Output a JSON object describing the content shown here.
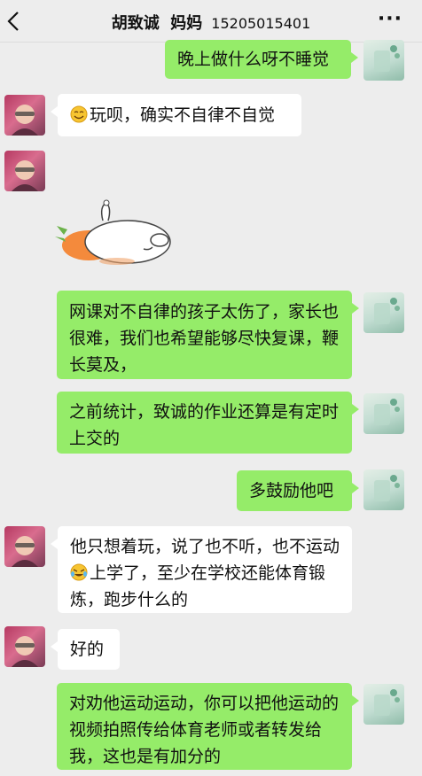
{
  "header": {
    "title": "胡致诚  妈妈",
    "phone": "15205015401",
    "more_icon": "more-dots-icon",
    "back_icon": "back-chevron-icon"
  },
  "colors": {
    "background": "#ededed",
    "sent_bubble": "#95ec69",
    "received_bubble": "#ffffff"
  },
  "messages": [
    {
      "from": "me",
      "text": "晚上做什么呀不睡觉"
    },
    {
      "from": "mom",
      "text": "玩呗，确实不自律不自觉",
      "emoji": "smile-emoji-icon"
    },
    {
      "from": "mom",
      "sticker": "sleeping-rabbit-carrot-sticker"
    },
    {
      "from": "me",
      "text": "网课对不自律的孩子太伤了，家长也很难，我们也希望能够尽快复课，鞭长莫及，"
    },
    {
      "from": "me",
      "text": "之前统计，致诚的作业还算是有定时上交的"
    },
    {
      "from": "me",
      "text": "多鼓励他吧"
    },
    {
      "from": "mom",
      "text_a": "他只想着玩，说了也不听，也不运动",
      "text_b": "上学了，至少在学校还能体育锻炼，跑步什么的",
      "emoji": "crying-laughing-emoji-icon"
    },
    {
      "from": "mom",
      "text": "好的"
    },
    {
      "from": "me",
      "text": "对劝他运动运动，你可以把他运动的视频拍照传给体育老师或者转发给我，这也是有加分的"
    }
  ]
}
